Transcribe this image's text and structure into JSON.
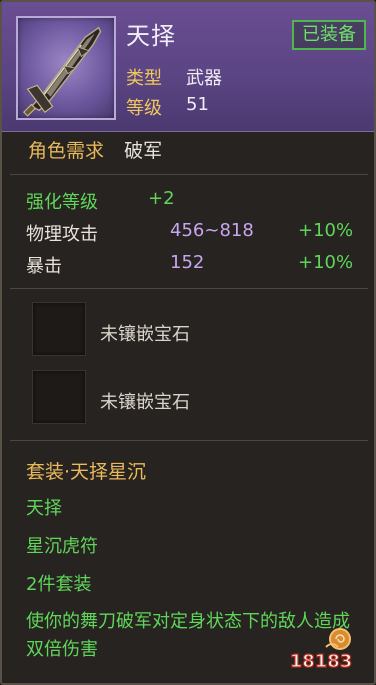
{
  "item": {
    "name": "天择",
    "equipped_label": "已装备",
    "type_label": "类型",
    "type_value": "武器",
    "level_label": "等级",
    "level_value": "51"
  },
  "requirement": {
    "label": "角色需求",
    "value": "破军"
  },
  "stats": {
    "enhance_label": "强化等级",
    "enhance_value": "+2",
    "rows": [
      {
        "label": "物理攻击",
        "value": "456~818",
        "bonus": "+10%"
      },
      {
        "label": "暴击",
        "value": "152",
        "bonus": "+10%"
      }
    ]
  },
  "sockets": [
    {
      "label": "未镶嵌宝石"
    },
    {
      "label": "未镶嵌宝石"
    }
  ],
  "set": {
    "title": "套装·天择星沉",
    "pieces": [
      "天择",
      "星沉虎符"
    ],
    "bonus_label": "2件套装",
    "description": "使你的舞刀破军对定身状态下的敌人造成双倍伤害"
  },
  "watermark": {
    "text": "18183",
    "icon": "snail-logo"
  },
  "colors": {
    "header_purple": "#5c4584",
    "label_gold": "#f0c85a",
    "value_purple": "#c7a6f0",
    "bonus_green": "#5fd65a",
    "badge_green": "#4fb84a"
  }
}
